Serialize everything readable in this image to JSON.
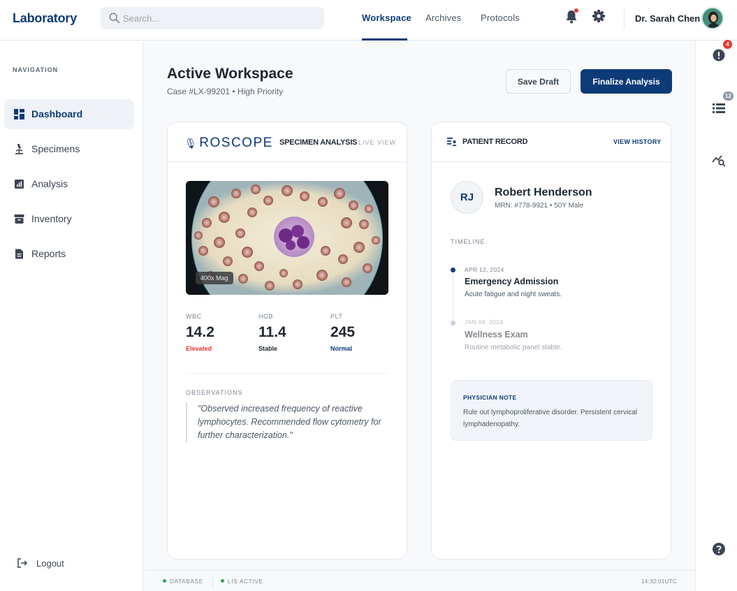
{
  "app": {
    "title": "Laboratory"
  },
  "search": {
    "placeholder": "Search..."
  },
  "top_nav": {
    "tabs": [
      {
        "label": "Workspace",
        "active": true
      },
      {
        "label": "Archives",
        "active": false
      },
      {
        "label": "Protocols",
        "active": false
      }
    ]
  },
  "header_icons": {
    "notifications": "bell-icon",
    "settings": "gear-icon"
  },
  "user": {
    "name": "Dr. Sarah Chen"
  },
  "sidebar": {
    "heading": "NAVIGATION",
    "items": [
      {
        "label": "Dashboard",
        "icon": "dashboard-icon",
        "active": true
      },
      {
        "label": "Specimens",
        "icon": "microscope-icon",
        "active": false
      },
      {
        "label": "Analysis",
        "icon": "bar-chart-icon",
        "active": false
      },
      {
        "label": "Inventory",
        "icon": "archive-box-icon",
        "active": false
      },
      {
        "label": "Reports",
        "icon": "document-icon",
        "active": false
      }
    ],
    "logout": "Logout"
  },
  "rail": {
    "alerts_badge": "4",
    "tasks_badge": "12"
  },
  "workspace": {
    "title": "Active Workspace",
    "subtitle": "Case #LX-99201 • High Priority",
    "save_draft": "Save Draft",
    "finalize": "Finalize Analysis"
  },
  "specimen": {
    "brand": "ROSCOPE",
    "title": "SPECIMEN ANALYSIS",
    "live": "LIVE VIEW",
    "magnification": "400x Mag",
    "stats": [
      {
        "key": "WBC",
        "value": "14.2",
        "status": "Elevated",
        "color": "#e53935"
      },
      {
        "key": "HGB",
        "value": "11.4",
        "status": "Stable",
        "color": "#1f2733"
      },
      {
        "key": "PLT",
        "value": "245",
        "status": "Normal",
        "color": "#0d3b78"
      }
    ],
    "observations_label": "OBSERVATIONS",
    "observations": "\"Observed increased frequency of reactive lymphocytes. Recommended flow cytometry for further characterization.\""
  },
  "patient": {
    "title": "PATIENT RECORD",
    "view_history": "VIEW HISTORY",
    "initials": "RJ",
    "name": "Robert Henderson",
    "mrn": "MRN: #778-9921 • 50Y Male",
    "timeline_label": "TIMELINE",
    "timeline": [
      {
        "date": "APR 12, 2024",
        "title": "Emergency Admission",
        "desc": "Acute fatigue and night sweats."
      },
      {
        "date": "JAN 04, 2024",
        "title": "Wellness Exam",
        "desc": "Routine metabolic panel stable."
      }
    ],
    "note_label": "PHYSICIAN NOTE",
    "note": "Rule out lymphoproliferative disorder. Persistent cervical lymphadenopathy."
  },
  "footer": {
    "db": "DATABASE",
    "lis": "LIS ACTIVE",
    "time": "14:32:01UTC"
  },
  "colors": {
    "brand": "#0d3b78",
    "alert": "#e53935",
    "ok": "#2ea44f"
  }
}
